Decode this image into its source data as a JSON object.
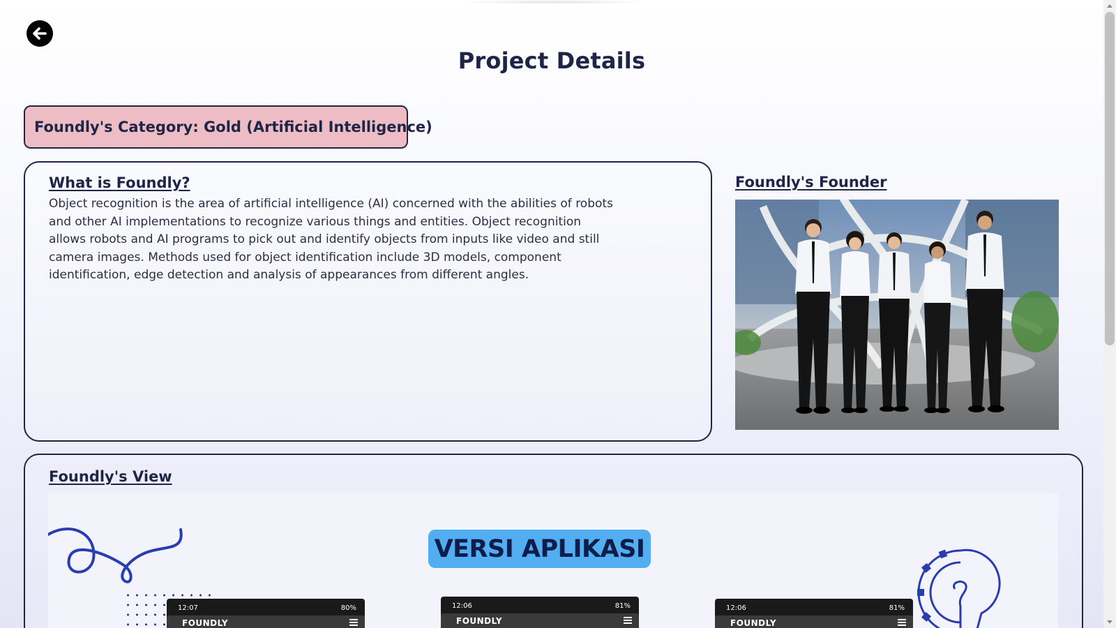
{
  "page": {
    "title": "Project Details"
  },
  "category": {
    "label": "Foundly's Category: Gold (Artificial Intelligence)"
  },
  "about": {
    "heading": "What is Foundly?",
    "text": "Object recognition is the area of artificial intelligence (AI) concerned with the abilities of robots and other AI implementations to recognize various things and entities. Object recognition allows robots and AI programs to pick out and identify objects from inputs like video and still camera images. Methods used for object identification include 3D models, component identification, edge detection and analysis of appearances from different angles."
  },
  "founder": {
    "heading": "Foundly's Founder"
  },
  "view": {
    "heading": "Foundly's View",
    "banner": "VERSI APLIKASI",
    "phones": [
      {
        "time": "12:07",
        "battery": "80%",
        "brand": "FOUNDLY"
      },
      {
        "time": "12:06",
        "battery": "81%",
        "brand": "FOUNDLY"
      },
      {
        "time": "12:06",
        "battery": "81%",
        "brand": "FOUNDLY"
      }
    ]
  },
  "icons": {
    "back": "arrow-left-icon",
    "menu": "hamburger-menu-icon",
    "idea": "lightbulb-gear-icon"
  },
  "colors": {
    "primary": "#1f2547",
    "category_bg": "#eebcc4",
    "banner_bg": "#53adf1",
    "doodle": "#2a3db0"
  }
}
